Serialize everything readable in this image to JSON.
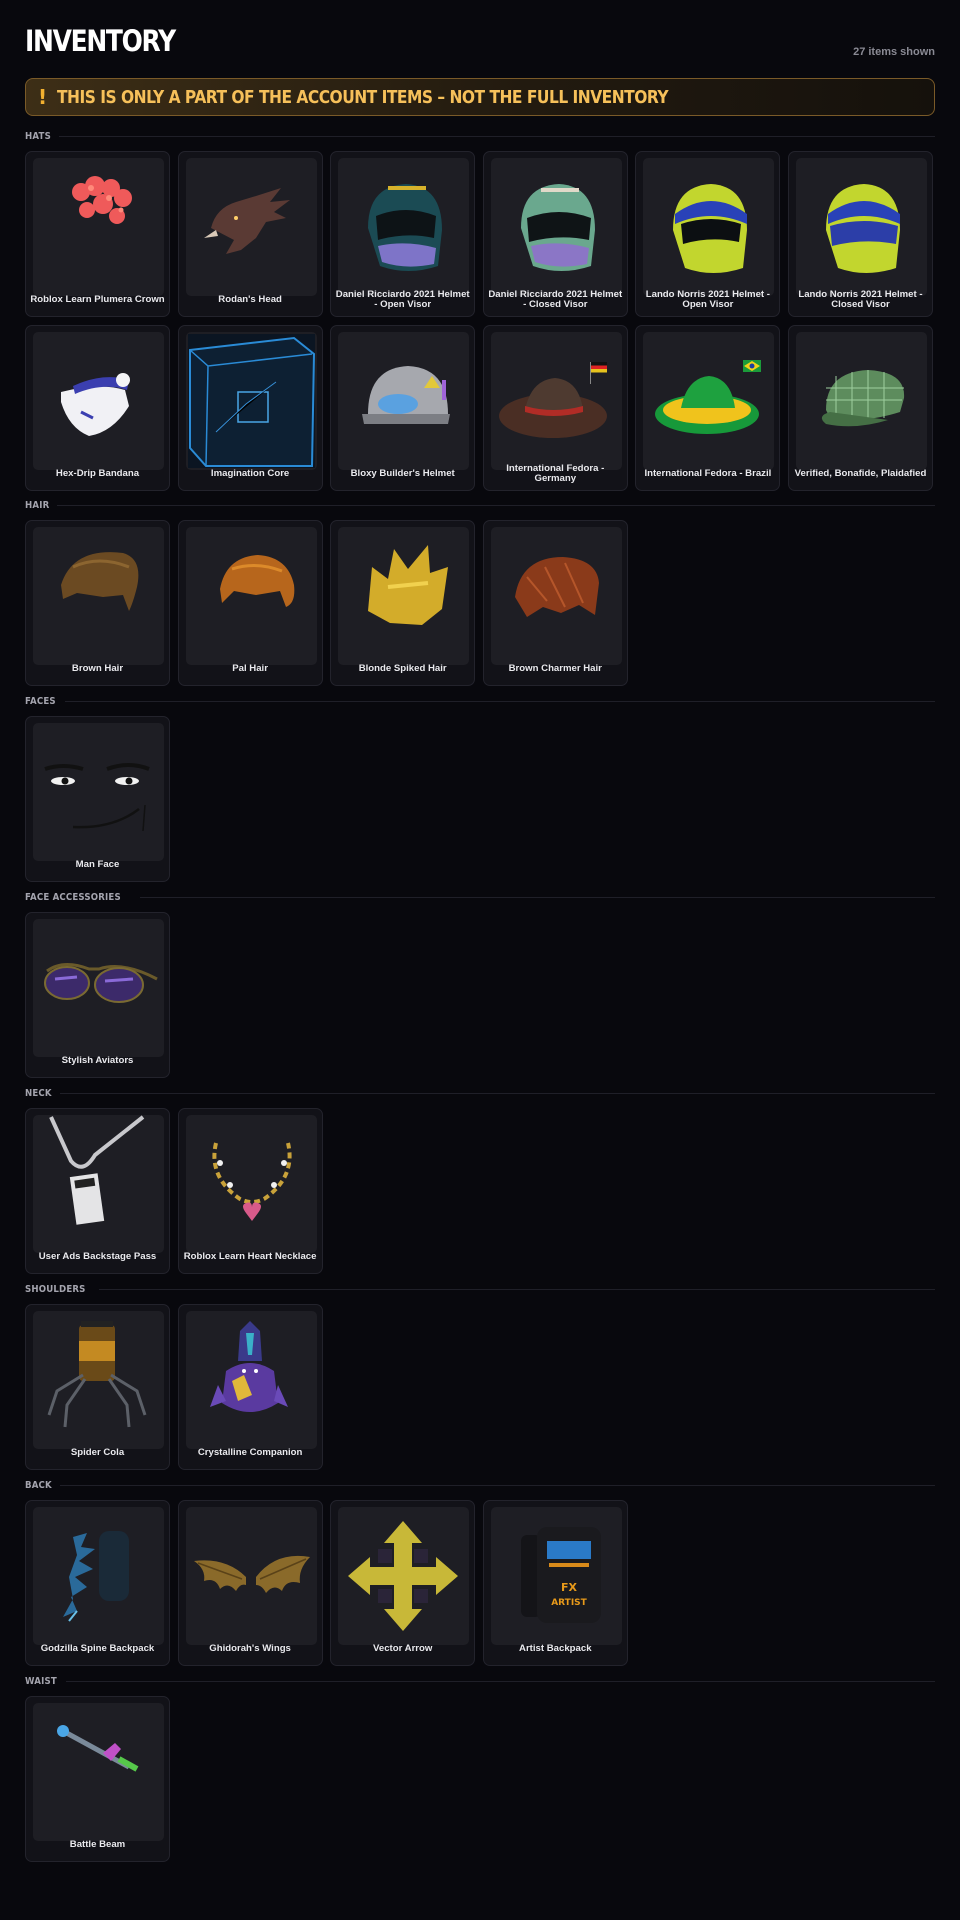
{
  "header": {
    "title": "INVENTORY",
    "count": "27 items shown",
    "banner_icon": "!",
    "banner_text": "THIS IS ONLY A PART OF THE ACCOUNT ITEMS – NOT THE FULL INVENTORY"
  },
  "colors": {
    "accent": "#f2b030",
    "background": "#08080d",
    "card": "#121218"
  },
  "sections": [
    {
      "title": "HATS",
      "items": [
        {
          "name": "Roblox Learn Plumera Crown",
          "icon": "plumeria-crown-icon"
        },
        {
          "name": "Rodan's Head",
          "icon": "rodan-head-icon"
        },
        {
          "name": "Daniel Ricciardo 2021 Helmet - Open Visor",
          "icon": "helmet-icon"
        },
        {
          "name": "Daniel Ricciardo 2021 Helmet - Closed Visor",
          "icon": "helmet-icon"
        },
        {
          "name": "Lando Norris 2021 Helmet - Open Visor",
          "icon": "helmet-icon"
        },
        {
          "name": "Lando Norris 2021 Helmet - Closed Visor",
          "icon": "helmet-icon"
        },
        {
          "name": "Hex-Drip Bandana",
          "icon": "bandana-icon"
        },
        {
          "name": "Imagination Core",
          "icon": "cube-icon"
        },
        {
          "name": "Bloxy Builder's Helmet",
          "icon": "hard-hat-icon"
        },
        {
          "name": "International Fedora - Germany",
          "icon": "fedora-icon"
        },
        {
          "name": "International Fedora - Brazil",
          "icon": "fedora-icon"
        },
        {
          "name": "Verified, Bonafide, Plaidafied",
          "icon": "plaid-cap-icon"
        }
      ]
    },
    {
      "title": "HAIR",
      "items": [
        {
          "name": "Brown Hair",
          "icon": "hair-icon"
        },
        {
          "name": "Pal Hair",
          "icon": "hair-icon"
        },
        {
          "name": "Blonde Spiked Hair",
          "icon": "spiked-hair-icon"
        },
        {
          "name": "Brown Charmer Hair",
          "icon": "hair-icon"
        }
      ]
    },
    {
      "title": "FACES",
      "items": [
        {
          "name": "Man Face",
          "icon": "face-icon"
        }
      ]
    },
    {
      "title": "FACE ACCESSORIES",
      "items": [
        {
          "name": "Stylish Aviators",
          "icon": "sunglasses-icon"
        }
      ]
    },
    {
      "title": "NECK",
      "items": [
        {
          "name": "User Ads Backstage Pass",
          "icon": "lanyard-pass-icon"
        },
        {
          "name": "Roblox Learn Heart Necklace",
          "icon": "necklace-icon"
        }
      ]
    },
    {
      "title": "SHOULDERS",
      "items": [
        {
          "name": "Spider Cola",
          "icon": "spider-cola-icon"
        },
        {
          "name": "Crystalline Companion",
          "icon": "crystal-companion-icon"
        }
      ]
    },
    {
      "title": "BACK",
      "items": [
        {
          "name": "Godzilla Spine Backpack",
          "icon": "spine-backpack-icon"
        },
        {
          "name": "Ghidorah's Wings",
          "icon": "wings-icon"
        },
        {
          "name": "Vector Arrow",
          "icon": "arrows-icon"
        },
        {
          "name": "Artist Backpack",
          "icon": "backpack-icon"
        }
      ]
    },
    {
      "title": "WAIST",
      "items": [
        {
          "name": "Battle Beam",
          "icon": "beam-sword-icon"
        }
      ]
    }
  ]
}
